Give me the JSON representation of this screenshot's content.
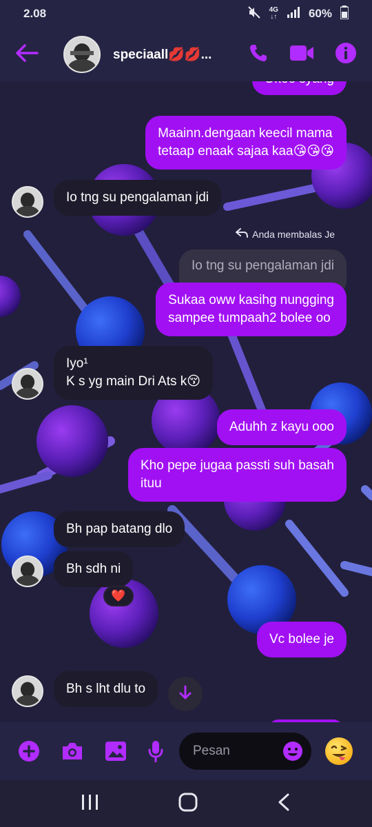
{
  "status_bar": {
    "time": "2.08",
    "network": "4G",
    "battery": "60%"
  },
  "header": {
    "contact_name": "speciaall💋💋...",
    "back_icon": "back-arrow-icon",
    "call_icon": "phone-icon",
    "video_icon": "video-icon",
    "info_icon": "info-icon"
  },
  "messages": [
    {
      "dir": "out",
      "text": "Okee syang"
    },
    {
      "dir": "out",
      "text": "Maainn.dengaan keecil mama\ntetaap enaak sajaa kaa😘😘😘"
    },
    {
      "dir": "in",
      "text": "Io tng su pengalaman jdi"
    },
    {
      "dir": "note",
      "text": "Anda membalas Je"
    },
    {
      "dir": "quote",
      "text": "Io tng su pengalaman jdi"
    },
    {
      "dir": "out",
      "text": "Sukaa oww kasihg nungging\nsampee tumpaah2 bolee oo"
    },
    {
      "dir": "in",
      "text": "Iyo¹\nK s yg main Dri Ats k😚"
    },
    {
      "dir": "out",
      "text": "Aduhh z kayu  ooo"
    },
    {
      "dir": "out",
      "text": "Kho pepe jugaa passti suh basah\nituu"
    },
    {
      "dir": "in",
      "text": "Bh pap batang dlo"
    },
    {
      "dir": "in",
      "text": "Bh sdh ni"
    },
    {
      "dir": "reaction",
      "text": "❤️"
    },
    {
      "dir": "out",
      "text": "Vc bolee je"
    },
    {
      "dir": "in",
      "text": "Bh s lht dlu to"
    }
  ],
  "composer": {
    "placeholder": "Pesan",
    "icons": [
      "plus-icon",
      "camera-icon",
      "gallery-icon",
      "microphone-icon",
      "emoji-icon"
    ]
  },
  "nav": {
    "icons": [
      "recents-icon",
      "home-icon",
      "back-icon"
    ]
  },
  "colors": {
    "accent": "#a110f3",
    "incoming": "#1e1b2c",
    "background": "#221f3c"
  }
}
